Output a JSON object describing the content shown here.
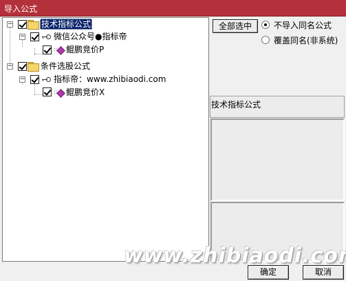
{
  "window": {
    "title": "导入公式"
  },
  "tree": {
    "nodes": [
      {
        "label": "技术指标公式",
        "kind": "folder",
        "checked": true,
        "expanded": true,
        "selected": true
      },
      {
        "label": "微信公众号●指标帝",
        "kind": "key",
        "checked": true,
        "expanded": true
      },
      {
        "label": "鲲鹏竞价P",
        "kind": "formula",
        "checked": true
      },
      {
        "label": "条件选股公式",
        "kind": "folder",
        "checked": true,
        "expanded": true
      },
      {
        "label": "指标帝：www.zhibiaodi.com",
        "kind": "key",
        "checked": true,
        "expanded": true
      },
      {
        "label": "鲲鹏竞价X",
        "kind": "formula",
        "checked": true
      }
    ]
  },
  "options": {
    "select_all_label": "全部选中",
    "radios": [
      {
        "label": "不导入同名公式",
        "selected": true
      },
      {
        "label": "覆盖同名(非系统)",
        "selected": false
      }
    ]
  },
  "info": {
    "category_label": "技术指标公式"
  },
  "footer": {
    "ok_label": "确定",
    "cancel_label": "取消",
    "watermark": "www.zhibiaodi.com"
  },
  "colors": {
    "titlebar": "#b4303a",
    "selection": "#0a246a"
  }
}
